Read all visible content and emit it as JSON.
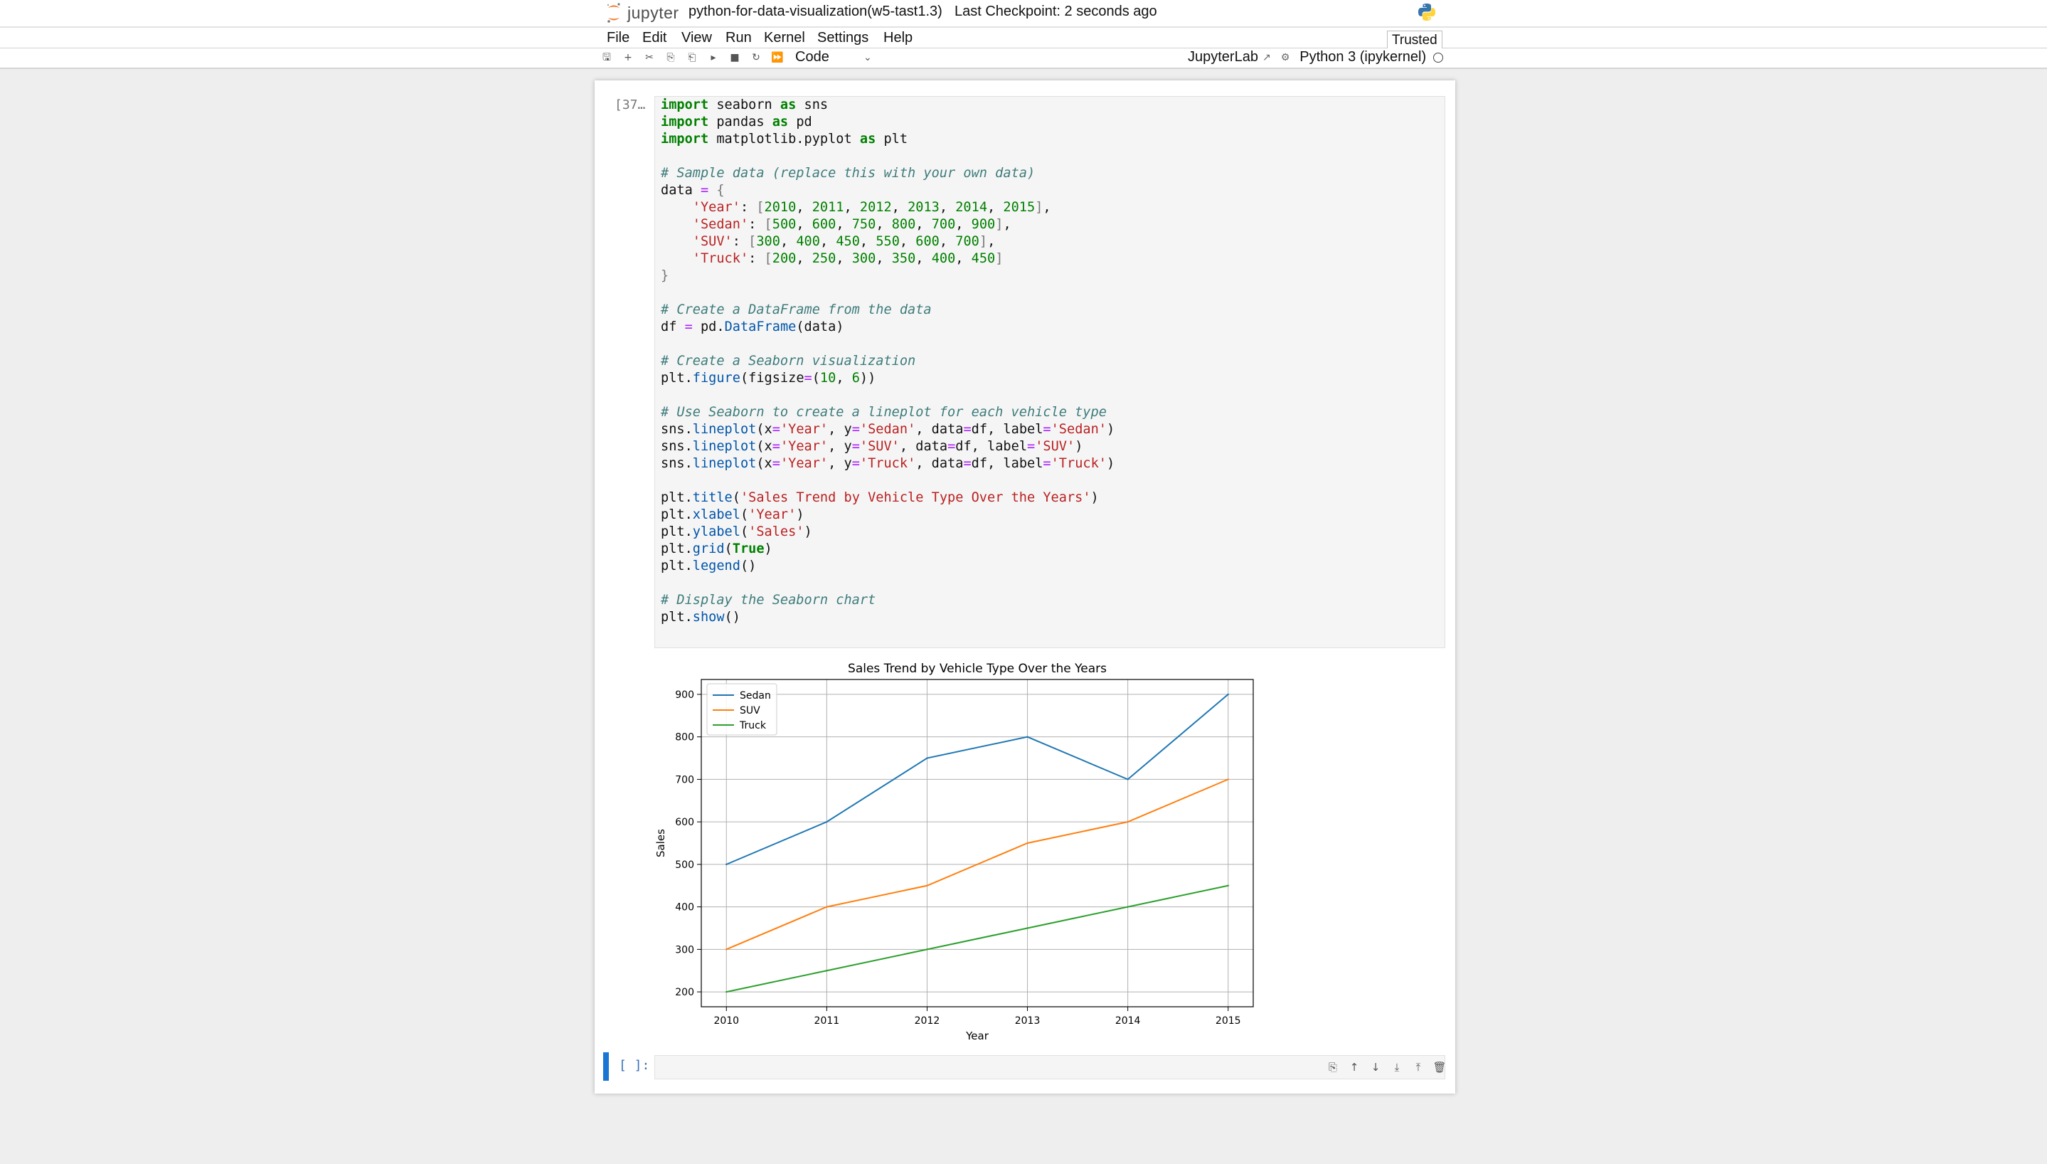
{
  "header": {
    "logo_text": "jupyter",
    "notebook_title": "python-for-data-visualization(w5-tast1.3)",
    "checkpoint": "Last Checkpoint: 2 seconds ago",
    "trusted": "Trusted"
  },
  "menu": [
    "File",
    "Edit",
    "View",
    "Run",
    "Kernel",
    "Settings",
    "Help"
  ],
  "toolbar": {
    "icons": [
      "save-icon",
      "add-cell-icon",
      "cut-icon",
      "copy-icon",
      "paste-icon",
      "run-icon",
      "stop-icon",
      "restart-icon",
      "fast-forward-icon"
    ],
    "cell_type": "Code",
    "jupyterlab_label": "JupyterLab",
    "kernel_name": "Python 3 (ipykernel)"
  },
  "cells": {
    "code_prompt": "[37…",
    "empty_prompt": "[ ]:"
  },
  "code_lines": [
    "import seaborn as sns",
    "import pandas as pd",
    "import matplotlib.pyplot as plt",
    "",
    "# Sample data (replace this with your own data)",
    "data = {",
    "    'Year': [2010, 2011, 2012, 2013, 2014, 2015],",
    "    'Sedan': [500, 600, 750, 800, 700, 900],",
    "    'SUV': [300, 400, 450, 550, 600, 700],",
    "    'Truck': [200, 250, 300, 350, 400, 450]",
    "}",
    "",
    "# Create a DataFrame from the data",
    "df = pd.DataFrame(data)",
    "",
    "# Create a Seaborn visualization",
    "plt.figure(figsize=(10, 6))",
    "",
    "# Use Seaborn to create a lineplot for each vehicle type",
    "sns.lineplot(x='Year', y='Sedan', data=df, label='Sedan')",
    "sns.lineplot(x='Year', y='SUV', data=df, label='SUV')",
    "sns.lineplot(x='Year', y='Truck', data=df, label='Truck')",
    "",
    "plt.title('Sales Trend by Vehicle Type Over the Years')",
    "plt.xlabel('Year')",
    "plt.ylabel('Sales')",
    "plt.grid(True)",
    "plt.legend()",
    "",
    "# Display the Seaborn chart",
    "plt.show()"
  ],
  "cell_tools": [
    "duplicate-icon",
    "move-up-icon",
    "move-down-icon",
    "insert-below-icon",
    "insert-above-icon",
    "delete-icon"
  ],
  "chart_data": {
    "type": "line",
    "title": "Sales Trend by Vehicle Type Over the Years",
    "xlabel": "Year",
    "ylabel": "Sales",
    "x": [
      2010,
      2011,
      2012,
      2013,
      2014,
      2015
    ],
    "xlim": [
      2009.75,
      2015.25
    ],
    "ylim": [
      165,
      935
    ],
    "yticks": [
      200,
      300,
      400,
      500,
      600,
      700,
      800,
      900
    ],
    "grid": true,
    "legend_position": "top-left",
    "series": [
      {
        "name": "Sedan",
        "color": "#1f77b4",
        "values": [
          500,
          600,
          750,
          800,
          700,
          900
        ]
      },
      {
        "name": "SUV",
        "color": "#ff7f0e",
        "values": [
          300,
          400,
          450,
          550,
          600,
          700
        ]
      },
      {
        "name": "Truck",
        "color": "#2ca02c",
        "values": [
          200,
          250,
          300,
          350,
          400,
          450
        ]
      }
    ]
  }
}
